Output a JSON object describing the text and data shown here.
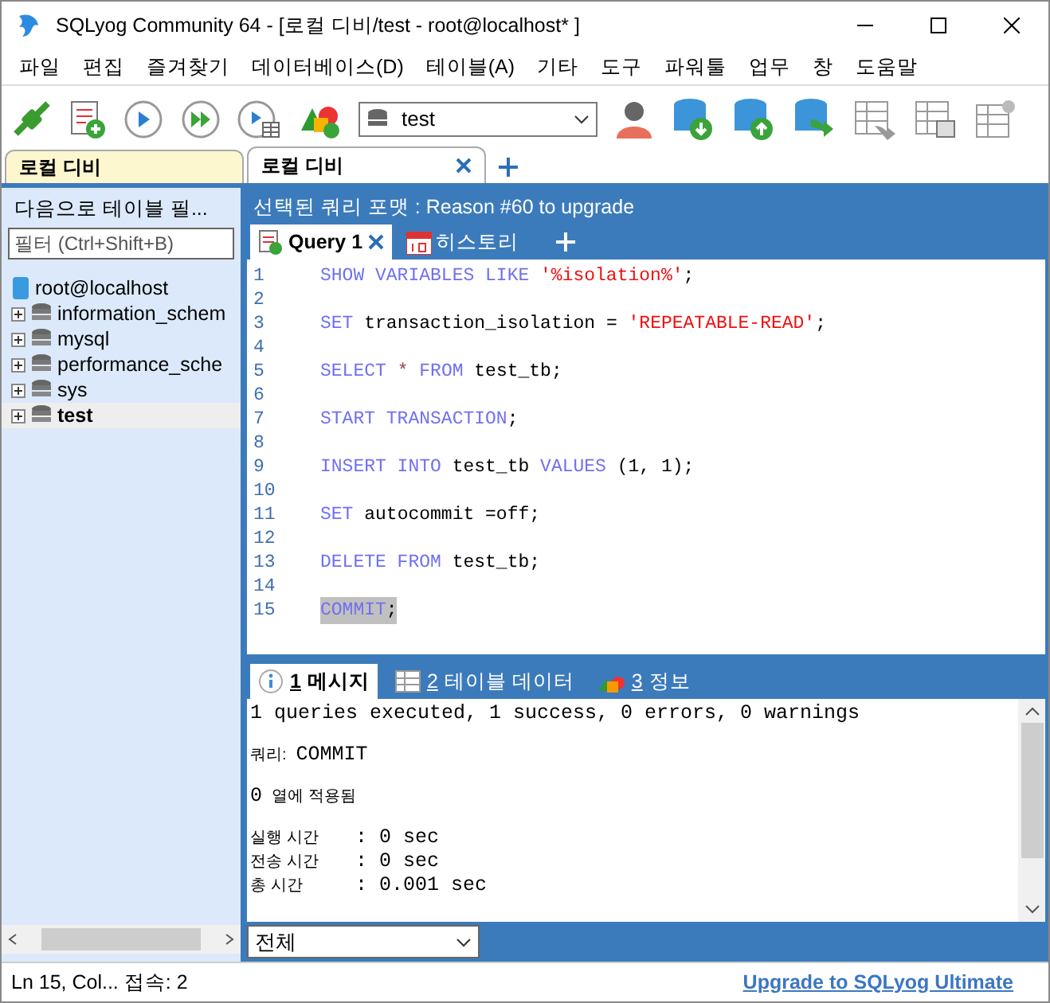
{
  "window": {
    "title": "SQLyog Community 64 - [로컬 디비/test - root@localhost* ]"
  },
  "menu": [
    "파일",
    "편집",
    "즐겨찾기",
    "데이터베이스(D)",
    "테이블(A)",
    "기타",
    "도구",
    "파워툴",
    "업무",
    "창",
    "도움말"
  ],
  "toolbar": {
    "database": "test"
  },
  "connection_tabs": [
    {
      "label": "로컬 디비",
      "selected": false
    },
    {
      "label": "로컬 디비",
      "selected": true
    }
  ],
  "object_browser": {
    "heading": "다음으로 테이블 필...",
    "filter_placeholder": "필터 (Ctrl+Shift+B)",
    "tree": [
      {
        "label": "root@localhost",
        "selected": false,
        "children": [
          {
            "label": "information_schem",
            "selected": false,
            "expanded": false
          },
          {
            "label": "mysql",
            "selected": false,
            "expanded": false
          },
          {
            "label": "performance_sche",
            "selected": false,
            "expanded": false
          },
          {
            "label": "sys",
            "selected": false,
            "expanded": false
          },
          {
            "label": "test",
            "selected": true,
            "expanded": false
          }
        ]
      }
    ]
  },
  "info_bar": "선택된 쿼리 포맷 : Reason #60 to upgrade",
  "query_tabs": [
    {
      "kind": "query",
      "label": "Query 1",
      "selected": true
    },
    {
      "kind": "history",
      "label": "히스토리",
      "selected": false
    }
  ],
  "editor": [
    {
      "number": "1",
      "selected": false,
      "tokens": [
        {
          "kind": "keyword",
          "text": "SHOW VARIABLES LIKE"
        },
        {
          "kind": "string",
          "text": "'%isolation%'"
        },
        {
          "kind": "punct",
          "text": ";"
        }
      ]
    },
    {
      "number": "2"
    },
    {
      "number": "3",
      "selected": false,
      "tokens": [
        {
          "kind": "keyword",
          "text": "SET"
        },
        {
          "kind": "plain",
          "text": "transaction_isolation ="
        },
        {
          "kind": "string",
          "text": "'REPEATABLE-READ'"
        },
        {
          "kind": "punct",
          "text": ";"
        }
      ]
    },
    {
      "number": "4"
    },
    {
      "number": "5",
      "selected": false,
      "tokens": [
        {
          "kind": "keyword",
          "text": "SELECT"
        },
        {
          "kind": "operator",
          "text": "*"
        },
        {
          "kind": "keyword",
          "text": "FROM"
        },
        {
          "kind": "plain",
          "text": "test_tb;"
        }
      ]
    },
    {
      "number": "6"
    },
    {
      "number": "7",
      "selected": false,
      "tokens": [
        {
          "kind": "keyword",
          "text": "START TRANSACTION"
        },
        {
          "kind": "punct",
          "text": ";"
        }
      ]
    },
    {
      "number": "8"
    },
    {
      "number": "9",
      "selected": false,
      "tokens": [
        {
          "kind": "keyword",
          "text": "INSERT INTO"
        },
        {
          "kind": "plain",
          "text": "test_tb"
        },
        {
          "kind": "keyword",
          "text": "VALUES"
        },
        {
          "kind": "plain",
          "text": "(1, 1);"
        }
      ]
    },
    {
      "number": "10"
    },
    {
      "number": "11",
      "selected": false,
      "tokens": [
        {
          "kind": "keyword",
          "text": "SET"
        },
        {
          "kind": "plain",
          "text": "autocommit =off;"
        }
      ]
    },
    {
      "number": "12"
    },
    {
      "number": "13",
      "selected": false,
      "tokens": [
        {
          "kind": "keyword",
          "text": "DELETE FROM"
        },
        {
          "kind": "plain",
          "text": "test_tb;"
        }
      ]
    },
    {
      "number": "14"
    },
    {
      "number": "15",
      "selected": true,
      "tokens": [
        {
          "kind": "keyword",
          "text": "COMMIT"
        },
        {
          "kind": "punct",
          "text": ";"
        }
      ]
    }
  ],
  "result_tabs": [
    {
      "kind": "messages",
      "key": "1",
      "label": "메시지",
      "selected": true
    },
    {
      "kind": "table",
      "key": "2",
      "label": "테이블 데이터",
      "selected": false
    },
    {
      "kind": "info",
      "key": "3",
      "label": "정보",
      "selected": false
    }
  ],
  "messages": [
    {
      "kind": "summary",
      "text": "1 queries executed, 1 success, 0 errors, 0 warnings"
    },
    {
      "kind": "query",
      "label": "쿼리:",
      "value": "COMMIT"
    },
    {
      "kind": "count",
      "value": "0",
      "label": "열에 적용됨"
    },
    {
      "kind": "timing",
      "label": "실행 시간",
      "value": ": 0 sec"
    },
    {
      "kind": "timing",
      "label": "전송 시간",
      "value": ": 0 sec"
    },
    {
      "kind": "timing",
      "label": "총 시간",
      "value": ": 0.001 sec"
    }
  ],
  "message_filter": "전체",
  "status_bar": {
    "text": "Ln 15, Col... 접속: 2",
    "link": "Upgrade to SQLyog Ultimate"
  }
}
